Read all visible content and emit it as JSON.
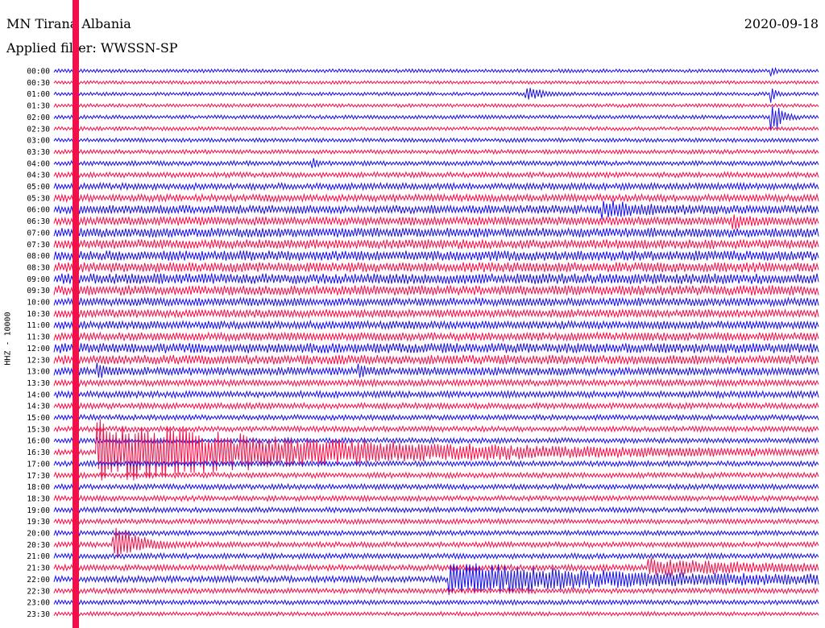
{
  "header": {
    "station": "MN Tirana Albania",
    "date": "2020-09-18",
    "filter": "Applied filter: WWSSN-SP"
  },
  "channel_label": "HHZ - 10000",
  "colors": {
    "even_rows": "#1a10e0",
    "odd_rows": "#f0104a",
    "marker": "#f0104a"
  },
  "chart_data": {
    "type": "line",
    "subtype": "helicorder",
    "y_tick_labels": [
      "00:00",
      "00:30",
      "01:00",
      "01:30",
      "02:00",
      "02:30",
      "03:00",
      "03:30",
      "04:00",
      "04:30",
      "05:00",
      "05:30",
      "06:00",
      "06:30",
      "07:00",
      "07:30",
      "08:00",
      "08:30",
      "09:00",
      "09:30",
      "10:00",
      "10:30",
      "11:00",
      "11:30",
      "12:00",
      "12:30",
      "13:00",
      "13:30",
      "14:00",
      "14:30",
      "15:00",
      "15:30",
      "16:00",
      "16:30",
      "17:00",
      "17:30",
      "18:00",
      "18:30",
      "19:00",
      "19:30",
      "20:00",
      "20:30",
      "21:00",
      "21:30",
      "22:00",
      "22:30",
      "23:00",
      "23:30"
    ],
    "row_duration_minutes": 30,
    "rows": [
      {
        "label": "00:00",
        "noise": 0.3,
        "bursts": [
          {
            "t": 0.94,
            "amp": 0.8,
            "decay": 0.004
          }
        ]
      },
      {
        "label": "00:30",
        "noise": 0.28,
        "bursts": []
      },
      {
        "label": "01:00",
        "noise": 0.3,
        "bursts": [
          {
            "t": 0.62,
            "amp": 0.9,
            "decay": 0.02
          },
          {
            "t": 0.94,
            "amp": 1.2,
            "decay": 0.004
          }
        ]
      },
      {
        "label": "01:30",
        "noise": 0.3,
        "bursts": []
      },
      {
        "label": "02:00",
        "noise": 0.32,
        "bursts": [
          {
            "t": 0.94,
            "amp": 3.0,
            "decay": 0.01
          }
        ]
      },
      {
        "label": "02:30",
        "noise": 0.32,
        "bursts": []
      },
      {
        "label": "03:00",
        "noise": 0.34,
        "bursts": []
      },
      {
        "label": "03:30",
        "noise": 0.36,
        "bursts": []
      },
      {
        "label": "04:00",
        "noise": 0.4,
        "bursts": [
          {
            "t": 0.34,
            "amp": 0.7,
            "decay": 0.006
          }
        ]
      },
      {
        "label": "04:30",
        "noise": 0.45,
        "bursts": []
      },
      {
        "label": "05:00",
        "noise": 0.55,
        "bursts": []
      },
      {
        "label": "05:30",
        "noise": 0.6,
        "bursts": []
      },
      {
        "label": "06:00",
        "noise": 0.75,
        "bursts": [
          {
            "t": 0.72,
            "amp": 1.0,
            "decay": 0.06
          }
        ]
      },
      {
        "label": "06:30",
        "noise": 0.75,
        "bursts": [
          {
            "t": 0.89,
            "amp": 1.0,
            "decay": 0.01
          }
        ]
      },
      {
        "label": "07:00",
        "noise": 0.8,
        "bursts": []
      },
      {
        "label": "07:30",
        "noise": 0.8,
        "bursts": []
      },
      {
        "label": "08:00",
        "noise": 0.85,
        "bursts": []
      },
      {
        "label": "08:30",
        "noise": 0.85,
        "bursts": []
      },
      {
        "label": "09:00",
        "noise": 0.9,
        "bursts": []
      },
      {
        "label": "09:30",
        "noise": 0.85,
        "bursts": []
      },
      {
        "label": "10:00",
        "noise": 0.7,
        "bursts": []
      },
      {
        "label": "10:30",
        "noise": 0.7,
        "bursts": []
      },
      {
        "label": "11:00",
        "noise": 0.7,
        "bursts": []
      },
      {
        "label": "11:30",
        "noise": 0.7,
        "bursts": []
      },
      {
        "label": "12:00",
        "noise": 0.85,
        "bursts": []
      },
      {
        "label": "12:30",
        "noise": 0.8,
        "bursts": []
      },
      {
        "label": "13:00",
        "noise": 0.7,
        "bursts": [
          {
            "t": 0.4,
            "amp": 1.2,
            "decay": 0.006
          },
          {
            "t": 0.06,
            "amp": 1.0,
            "decay": 0.006
          }
        ]
      },
      {
        "label": "13:30",
        "noise": 0.55,
        "bursts": []
      },
      {
        "label": "14:00",
        "noise": 0.55,
        "bursts": []
      },
      {
        "label": "14:30",
        "noise": 0.5,
        "bursts": []
      },
      {
        "label": "15:00",
        "noise": 0.45,
        "bursts": []
      },
      {
        "label": "15:30",
        "noise": 0.45,
        "bursts": []
      },
      {
        "label": "16:00",
        "noise": 0.45,
        "bursts": []
      },
      {
        "label": "16:30",
        "noise": 0.45,
        "bursts": [
          {
            "t": 0.06,
            "amp": 5.0,
            "decay": 0.3
          }
        ]
      },
      {
        "label": "17:00",
        "noise": 0.45,
        "bursts": []
      },
      {
        "label": "17:30",
        "noise": 0.45,
        "bursts": []
      },
      {
        "label": "18:00",
        "noise": 0.45,
        "bursts": []
      },
      {
        "label": "18:30",
        "noise": 0.45,
        "bursts": []
      },
      {
        "label": "19:00",
        "noise": 0.45,
        "bursts": []
      },
      {
        "label": "19:30",
        "noise": 0.42,
        "bursts": []
      },
      {
        "label": "20:00",
        "noise": 0.42,
        "bursts": []
      },
      {
        "label": "20:30",
        "noise": 0.45,
        "bursts": [
          {
            "t": 0.08,
            "amp": 3.0,
            "decay": 0.03
          }
        ]
      },
      {
        "label": "21:00",
        "noise": 0.45,
        "bursts": []
      },
      {
        "label": "21:30",
        "noise": 0.5,
        "bursts": [
          {
            "t": 0.78,
            "amp": 1.2,
            "decay": 0.15
          }
        ]
      },
      {
        "label": "22:00",
        "noise": 0.55,
        "bursts": [
          {
            "t": 0.52,
            "amp": 2.5,
            "decay": 0.25
          }
        ]
      },
      {
        "label": "22:30",
        "noise": 0.45,
        "bursts": []
      },
      {
        "label": "23:00",
        "noise": 0.4,
        "bursts": []
      },
      {
        "label": "23:30",
        "noise": 0.35,
        "bursts": []
      }
    ]
  }
}
